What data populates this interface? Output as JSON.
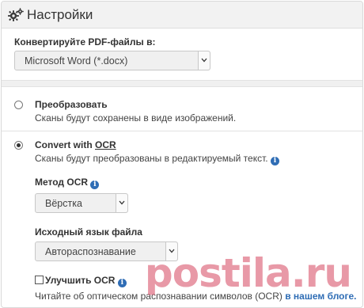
{
  "header": {
    "title": "Настройки",
    "icon": "gears-icon"
  },
  "convert": {
    "label": "Конвертируйте PDF-файлы в:",
    "format_value": "Microsoft Word (*.docx)"
  },
  "options": {
    "convert_images": {
      "title": "Преобразовать",
      "desc": "Сканы будут сохранены в виде изображений.",
      "selected": false
    },
    "convert_ocr": {
      "title_prefix": "Convert with ",
      "title_ocr": "OCR",
      "desc": "Сканы будут преобразованы в редактируемый текст.",
      "selected": true
    }
  },
  "ocr_method": {
    "label": "Метод OCR",
    "value": "Вёрстка"
  },
  "source_language": {
    "label": "Исходный язык файла",
    "value": "Автораспознавание"
  },
  "improve_ocr": {
    "label": "Улучшить OCR",
    "checked": false
  },
  "footer": {
    "text": "Читайте об оптическом распознавании символов (OCR) ",
    "link": "в нашем блоге."
  },
  "info_glyph": "i",
  "watermark": "postila.ru",
  "colors": {
    "accent": "#2f6db5",
    "header_bg": "#f2f2f2",
    "watermark": "#d6465f"
  }
}
